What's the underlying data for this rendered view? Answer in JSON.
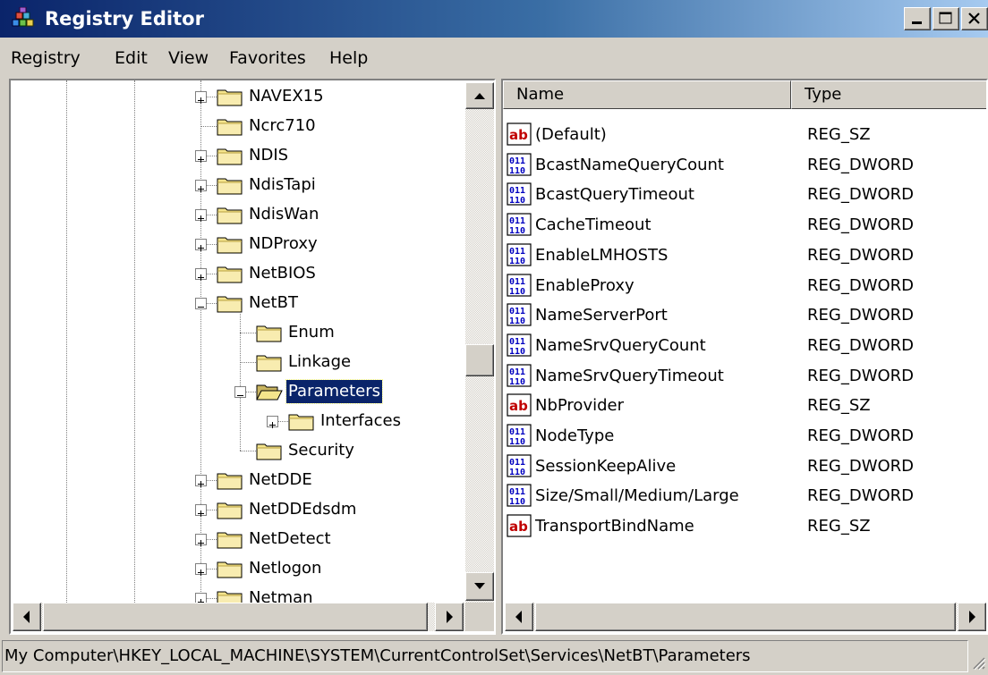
{
  "window": {
    "title": "Registry Editor",
    "controls": [
      "minimize",
      "maximize",
      "close"
    ]
  },
  "menu": [
    "Registry",
    "Edit",
    "View",
    "Favorites",
    "Help"
  ],
  "tree": {
    "items": [
      {
        "label": "NAVEX15",
        "level": 0,
        "expander": "plus",
        "icon": "folder-icon"
      },
      {
        "label": "Ncrc710",
        "level": 0,
        "expander": "none",
        "icon": "folder-icon"
      },
      {
        "label": "NDIS",
        "level": 0,
        "expander": "plus",
        "icon": "folder-icon"
      },
      {
        "label": "NdisTapi",
        "level": 0,
        "expander": "plus",
        "icon": "folder-icon"
      },
      {
        "label": "NdisWan",
        "level": 0,
        "expander": "plus",
        "icon": "folder-icon"
      },
      {
        "label": "NDProxy",
        "level": 0,
        "expander": "plus",
        "icon": "folder-icon"
      },
      {
        "label": "NetBIOS",
        "level": 0,
        "expander": "plus",
        "icon": "folder-icon"
      },
      {
        "label": "NetBT",
        "level": 0,
        "expander": "minus",
        "icon": "folder-icon"
      },
      {
        "label": "Enum",
        "level": 1,
        "expander": "none",
        "icon": "folder-icon"
      },
      {
        "label": "Linkage",
        "level": 1,
        "expander": "none",
        "icon": "folder-icon"
      },
      {
        "label": "Parameters",
        "level": 1,
        "expander": "minus",
        "icon": "open-folder-icon",
        "selected": true
      },
      {
        "label": "Interfaces",
        "level": 2,
        "expander": "plus",
        "icon": "folder-icon"
      },
      {
        "label": "Security",
        "level": 1,
        "expander": "none",
        "icon": "folder-icon"
      },
      {
        "label": "NetDDE",
        "level": 0,
        "expander": "plus",
        "icon": "folder-icon"
      },
      {
        "label": "NetDDEdsdm",
        "level": 0,
        "expander": "plus",
        "icon": "folder-icon"
      },
      {
        "label": "NetDetect",
        "level": 0,
        "expander": "plus",
        "icon": "folder-icon"
      },
      {
        "label": "Netlogon",
        "level": 0,
        "expander": "plus",
        "icon": "folder-icon"
      },
      {
        "label": "Netman",
        "level": 0,
        "expander": "plus",
        "icon": "folder-icon"
      }
    ]
  },
  "list": {
    "columns": [
      "Name",
      "Type"
    ],
    "rows": [
      {
        "name": "(Default)",
        "type": "REG_SZ",
        "icon": "string-value-icon"
      },
      {
        "name": "BcastNameQueryCount",
        "type": "REG_DWORD",
        "icon": "binary-value-icon"
      },
      {
        "name": "BcastQueryTimeout",
        "type": "REG_DWORD",
        "icon": "binary-value-icon"
      },
      {
        "name": "CacheTimeout",
        "type": "REG_DWORD",
        "icon": "binary-value-icon"
      },
      {
        "name": "EnableLMHOSTS",
        "type": "REG_DWORD",
        "icon": "binary-value-icon"
      },
      {
        "name": "EnableProxy",
        "type": "REG_DWORD",
        "icon": "binary-value-icon"
      },
      {
        "name": "NameServerPort",
        "type": "REG_DWORD",
        "icon": "binary-value-icon"
      },
      {
        "name": "NameSrvQueryCount",
        "type": "REG_DWORD",
        "icon": "binary-value-icon"
      },
      {
        "name": "NameSrvQueryTimeout",
        "type": "REG_DWORD",
        "icon": "binary-value-icon"
      },
      {
        "name": "NbProvider",
        "type": "REG_SZ",
        "icon": "string-value-icon"
      },
      {
        "name": "NodeType",
        "type": "REG_DWORD",
        "icon": "binary-value-icon"
      },
      {
        "name": "SessionKeepAlive",
        "type": "REG_DWORD",
        "icon": "binary-value-icon"
      },
      {
        "name": "Size/Small/Medium/Large",
        "type": "REG_DWORD",
        "icon": "binary-value-icon"
      },
      {
        "name": "TransportBindName",
        "type": "REG_SZ",
        "icon": "string-value-icon"
      }
    ]
  },
  "status": {
    "path": "My Computer\\HKEY_LOCAL_MACHINE\\SYSTEM\\CurrentControlSet\\Services\\NetBT\\Parameters"
  },
  "colors": {
    "title_start": "#0a246a",
    "title_end": "#a6caf0",
    "selection": "#0a246a",
    "folder": "#f4e48c"
  }
}
